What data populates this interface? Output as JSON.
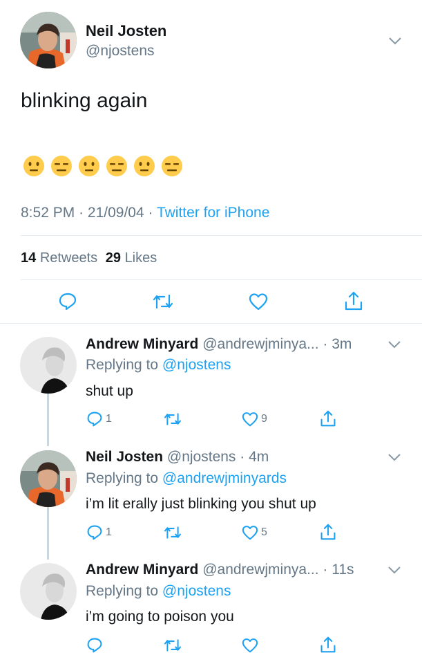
{
  "main_tweet": {
    "display_name": "Neil Josten",
    "handle": "@njostens",
    "text": "blinking again",
    "emojis": [
      "neutral-face",
      "expressionless-face",
      "neutral-face",
      "expressionless-face",
      "neutral-face",
      "expressionless-face"
    ],
    "time": "8:52 PM",
    "date": "21/09/04",
    "separator": "·",
    "source": "Twitter for iPhone",
    "retweets_count": "14",
    "retweets_label": "Retweets",
    "likes_count": "29",
    "likes_label": "Likes"
  },
  "replies": [
    {
      "display_name": "Andrew Minyard",
      "handle_time": "@andrewjminya... · 3m",
      "replying_to_label": "Replying to",
      "replying_to_handle": "@njostens",
      "text": "shut up",
      "reply_count": "1",
      "like_count": "9"
    },
    {
      "display_name": "Neil Josten",
      "handle_time": "@njostens · 4m",
      "replying_to_label": "Replying to",
      "replying_to_handle": "@andrewjminyards",
      "text": "i’m lit erally just blinking you shut up",
      "reply_count": "1",
      "like_count": "5"
    },
    {
      "display_name": "Andrew Minyard",
      "handle_time": "@andrewjminya... · 11s",
      "replying_to_label": "Replying to",
      "replying_to_handle": "@njostens",
      "text": "i’m going to poison you",
      "reply_count": "",
      "like_count": ""
    }
  ],
  "colors": {
    "accent": "#1da1f2",
    "muted": "#657786",
    "text": "#14171a",
    "divider": "#e6ecf0",
    "emoji": "#ffcc4d"
  }
}
